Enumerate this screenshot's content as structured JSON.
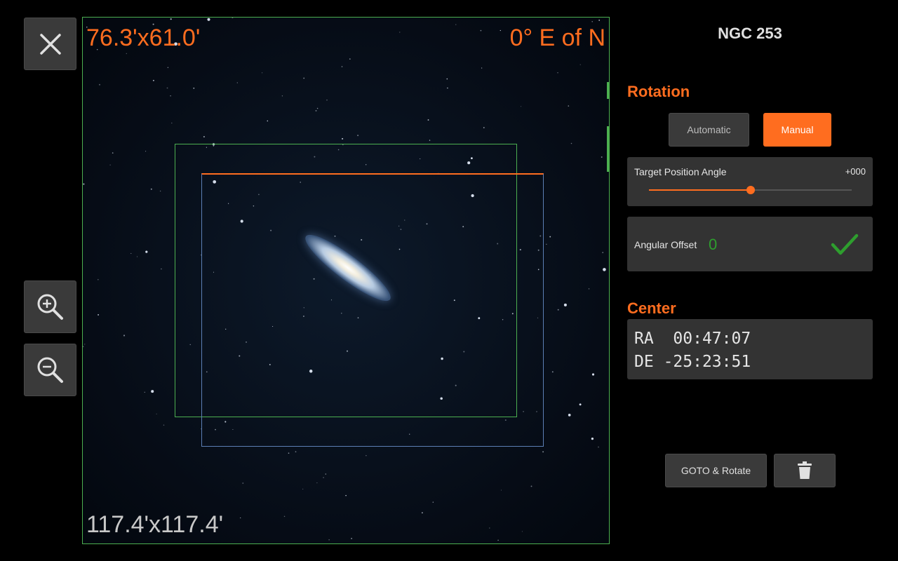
{
  "viewport": {
    "fov_top": "76.3'x61.0'",
    "angle_label": "0° E of N",
    "fov_bottom": "117.4'x117.4'"
  },
  "panel": {
    "object_name": "NGC 253",
    "rotation": {
      "title": "Rotation",
      "modes": {
        "automatic": "Automatic",
        "manual": "Manual",
        "selected": "Manual"
      },
      "target_position_angle": {
        "label": "Target Position Angle",
        "value": "+000",
        "slider_fraction": 0.5
      },
      "angular_offset": {
        "label": "Angular Offset",
        "value": "0"
      }
    },
    "center": {
      "title": "Center",
      "ra": {
        "label": "RA",
        "value": " 00:47:07"
      },
      "de": {
        "label": "DE",
        "value": "-25:23:51"
      }
    },
    "actions": {
      "goto_rotate": "GOTO & Rotate"
    }
  },
  "colors": {
    "accent": "#ff6d1f",
    "frame_green": "#4caf50",
    "frame_blue": "#5c7fb5",
    "confirm_green": "#2e9e2e",
    "background": "#000000"
  },
  "icons": {
    "close": "close-icon",
    "zoom_in": "zoom-in-icon",
    "zoom_out": "zoom-out-icon",
    "confirm": "checkmark-icon",
    "delete": "trash-icon"
  }
}
